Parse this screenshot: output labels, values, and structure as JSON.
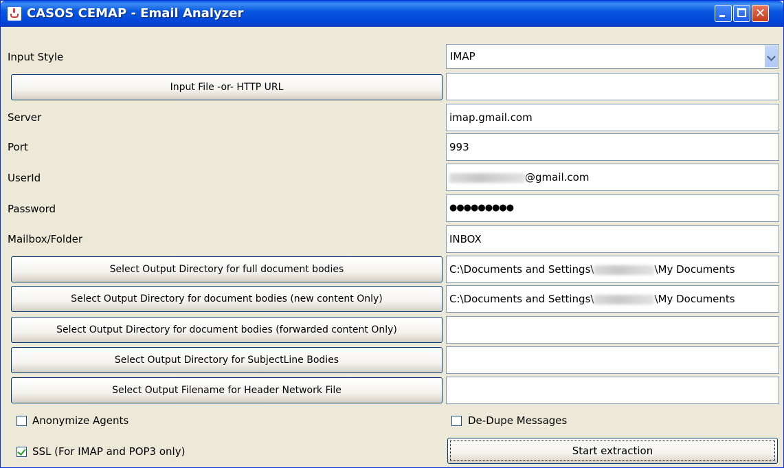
{
  "window": {
    "title": "CASOS CEMAP - Email Analyzer",
    "close_glyph": "✕"
  },
  "input_style": {
    "label": "Input Style",
    "selected": "IMAP"
  },
  "input_file_button": {
    "label": "Input File -or- HTTP URL",
    "value": ""
  },
  "server": {
    "label": "Server",
    "value": "imap.gmail.com"
  },
  "port": {
    "label": "Port",
    "value": "993"
  },
  "userid": {
    "label": "UserId",
    "value_suffix": "@gmail.com"
  },
  "password": {
    "label": "Password",
    "value": "●●●●●●●●●"
  },
  "mailbox": {
    "label": "Mailbox/Folder",
    "value": "INBOX"
  },
  "output_full": {
    "label": "Select Output Directory for full document bodies",
    "path_prefix": "C:\\Documents and Settings\\",
    "path_suffix": "\\My Documents"
  },
  "output_new": {
    "label": "Select Output Directory for document bodies (new content Only)",
    "path_prefix": "C:\\Documents and Settings\\",
    "path_suffix": "\\My Documents"
  },
  "output_forwarded": {
    "label": "Select Output Directory for document bodies (forwarded content Only)",
    "value": ""
  },
  "output_subject": {
    "label": "Select Output Directory for SubjectLine Bodies",
    "value": ""
  },
  "output_header": {
    "label": "Select Output Filename for Header Network File",
    "value": ""
  },
  "anonymize": {
    "label": "Anonymize Agents",
    "checked": false
  },
  "dedupe": {
    "label": "De-Dupe Messages",
    "checked": false
  },
  "ssl": {
    "label": "SSL (For IMAP and POP3 only)",
    "checked": true
  },
  "start_button": {
    "label": "Start extraction"
  }
}
